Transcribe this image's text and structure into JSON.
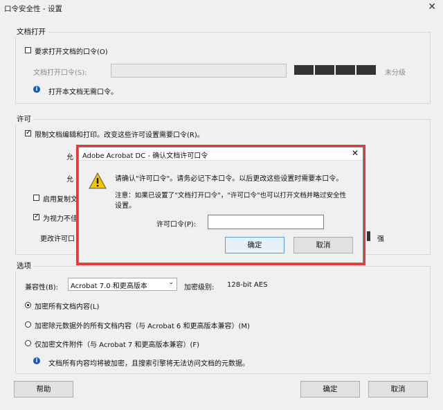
{
  "window": {
    "title": "口令安全性 - 设置"
  },
  "doc_open": {
    "section_title": "文档打开",
    "require_password_label": "要求打开文档的口令(O)",
    "password_label": "文档打开口令(S):",
    "strength_label": "未分级",
    "info_text": "打开本文档无需口令。"
  },
  "permissions": {
    "section_title": "许可",
    "restrict_label": "限制文档编辑和打印。改变这些许可设置需要口令(R)。",
    "row2_label": "允",
    "row3_label": "允",
    "enable_copy_label": "启用复制文",
    "accessibility_label": "为视力不佳",
    "change_password_label": "更改许可口",
    "strength_label": "强"
  },
  "options": {
    "section_title": "选项",
    "compat_label": "兼容性(B):",
    "compat_value": "Acrobat 7.0 和更高版本",
    "encryption_level_label": "加密级别:",
    "encryption_level_value": "128-bit AES",
    "radio_all": "加密所有文档内容(L)",
    "radio_except_metadata": "加密除元数据外的所有文档内容（与 Acrobat 6 和更高版本兼容）(M)",
    "radio_attachments": "仅加密文件附件（与 Acrobat 7 和更高版本兼容）(F)",
    "info_text": "文档所有内容均将被加密，且搜索引擎将无法访问文档的元数据。"
  },
  "footer": {
    "help": "帮助",
    "ok": "确定",
    "cancel": "取消"
  },
  "modal": {
    "title": "Adobe Acrobat DC - 确认文档许可口令",
    "message": "请确认\"许可口令\"。请务必记下本口令。以后更改这些设置时需要本口令。",
    "note_line1": "注意：如果已设置了\"文档打开口令\"，\"许可口令\"也可以打开文档并略过安全性",
    "note_line2": "设置。",
    "field_label": "许可口令(P):",
    "field_value": "",
    "ok": "确定",
    "cancel": "取消"
  }
}
